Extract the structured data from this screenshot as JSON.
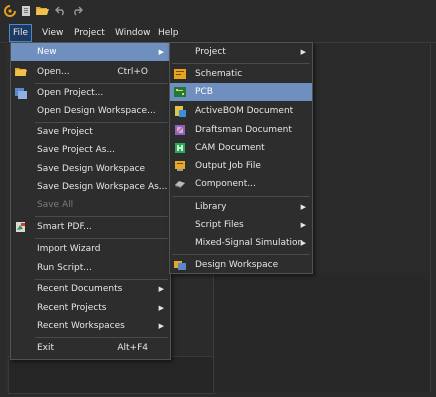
{
  "menubar": {
    "file": "File",
    "view": "View",
    "project": "Project",
    "window": "Window",
    "help": "Help"
  },
  "file_menu": {
    "new": "New",
    "open": "Open...",
    "open_shortcut": "Ctrl+O",
    "open_project": "Open Project...",
    "open_design_workspace": "Open Design Workspace...",
    "save_project": "Save Project",
    "save_project_as": "Save Project As...",
    "save_design_workspace": "Save Design Workspace",
    "save_design_workspace_as": "Save Design Workspace As...",
    "save_all": "Save All",
    "smart_pdf": "Smart PDF...",
    "import_wizard": "Import Wizard",
    "run_script": "Run Script...",
    "recent_documents": "Recent Documents",
    "recent_projects": "Recent Projects",
    "recent_workspaces": "Recent Workspaces",
    "exit": "Exit",
    "exit_shortcut": "Alt+F4"
  },
  "new_submenu": {
    "project": "Project",
    "schematic": "Schematic",
    "pcb": "PCB",
    "activebom": "ActiveBOM Document",
    "draftsman": "Draftsman Document",
    "cam": "CAM Document",
    "output_job": "Output Job File",
    "component": "Component...",
    "library": "Library",
    "script_files": "Script Files",
    "mixed_signal": "Mixed-Signal Simulation",
    "design_workspace": "Design Workspace"
  },
  "colors": {
    "highlight": "#6f8fbf",
    "menu_bg": "#2d2d2d",
    "app_bg": "#2b2b2b"
  }
}
